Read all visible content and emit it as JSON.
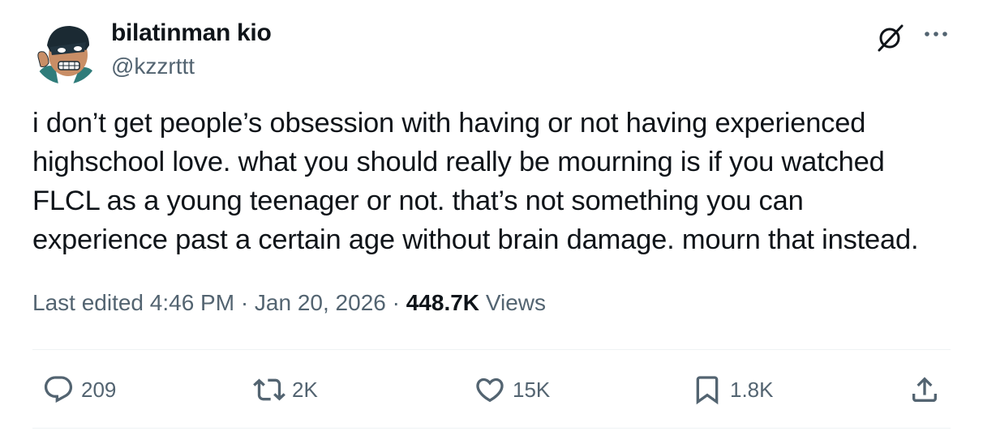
{
  "author": {
    "name": "bilatinman kio",
    "handle": "@kzzrttt"
  },
  "tweet": {
    "lines": [
      "i don’t get people’s obsession with having or not having experienced",
      "highschool love. what you should really be mourning is if you watched",
      "FLCL as a young teenager or not. that’s not something you can",
      "experience past a certain age without brain damage. mourn that instead."
    ]
  },
  "meta": {
    "edited": "Last edited 4:46 PM · Jan 20, 2026 ·",
    "views_count": "448.7K",
    "views_label": "Views"
  },
  "actions": {
    "replies": "209",
    "reposts": "2K",
    "likes": "15K",
    "bookmarks": "1.8K"
  },
  "icons": {
    "avatar": "avatar",
    "grok": "grok-icon",
    "more": "more-icon",
    "reply": "reply-icon",
    "repost": "repost-icon",
    "like": "heart-icon",
    "bookmark": "bookmark-icon",
    "share": "share-icon"
  },
  "colors": {
    "text": "#0f1419",
    "secondary": "#536471",
    "divider": "#eff3f4"
  }
}
